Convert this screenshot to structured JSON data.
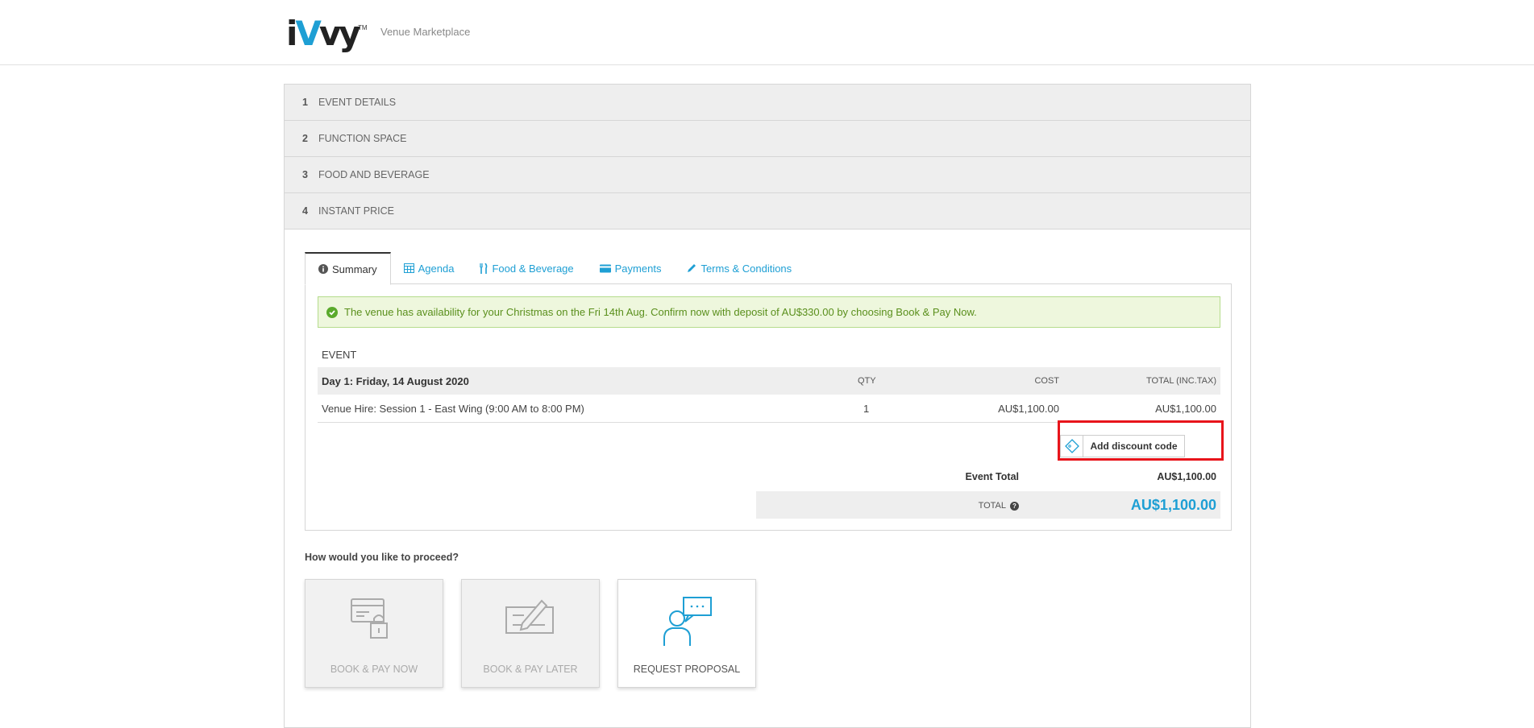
{
  "header": {
    "logo_text": "iVvy",
    "logo_tm": "TM",
    "subtitle": "Venue Marketplace"
  },
  "steps": [
    {
      "num": "1",
      "label": "EVENT DETAILS"
    },
    {
      "num": "2",
      "label": "FUNCTION SPACE"
    },
    {
      "num": "3",
      "label": "FOOD AND BEVERAGE"
    },
    {
      "num": "4",
      "label": "INSTANT PRICE"
    }
  ],
  "tabs": [
    {
      "label": "Summary",
      "icon": "info-icon",
      "active": true
    },
    {
      "label": "Agenda",
      "icon": "calendar-icon",
      "active": false
    },
    {
      "label": "Food & Beverage",
      "icon": "fork-knife-icon",
      "active": false
    },
    {
      "label": "Payments",
      "icon": "credit-card-icon",
      "active": false
    },
    {
      "label": "Terms & Conditions",
      "icon": "pen-icon",
      "active": false
    }
  ],
  "alert": {
    "text": "The venue has availability for your Christmas on the Fri 14th Aug. Confirm now with deposit of AU$330.00 by choosing Book & Pay Now."
  },
  "event": {
    "section_label": "EVENT",
    "day_heading": "Day 1: Friday, 14 August 2020",
    "columns": {
      "qty": "QTY",
      "cost": "COST",
      "total": "TOTAL (INC.TAX)"
    },
    "items": [
      {
        "description": "Venue Hire: Session 1 - East Wing (9:00 AM to 8:00 PM)",
        "qty": "1",
        "cost": "AU$1,100.00",
        "total": "AU$1,100.00"
      }
    ],
    "discount_label": "Add discount code",
    "event_total_label": "Event Total",
    "event_total_value": "AU$1,100.00",
    "total_label": "TOTAL",
    "total_value": "AU$1,100.00"
  },
  "proceed": {
    "question": "How would you like to proceed?",
    "options": [
      {
        "label": "BOOK & PAY NOW",
        "icon": "card-lock-icon",
        "enabled": false
      },
      {
        "label": "BOOK & PAY LATER",
        "icon": "cheque-pen-icon",
        "enabled": false
      },
      {
        "label": "REQUEST PROPOSAL",
        "icon": "person-chat-icon",
        "enabled": true
      }
    ]
  },
  "colors": {
    "accent": "#1e9fd4",
    "highlight": "#e8141b",
    "success": "#5aaa2b"
  }
}
